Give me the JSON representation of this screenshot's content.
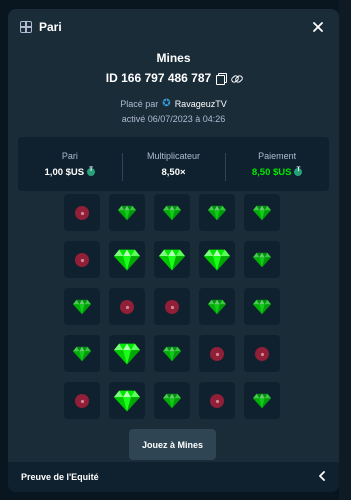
{
  "modal": {
    "title": "Pari",
    "game_name": "Mines",
    "bet_id": "ID 166 797 486 787",
    "placed_by_prefix": "Placé par",
    "placed_by_user": "RavageuzTV",
    "active_date": "activé 06/07/2023 à 04:26"
  },
  "stats": {
    "bet_label": "Pari",
    "bet_value": "1,00 $US",
    "multiplier_label": "Multiplicateur",
    "multiplier_value": "8,50×",
    "payout_label": "Paiement",
    "payout_value": "8,50 $US",
    "payout_color": "#00e701"
  },
  "grid": {
    "rows": [
      [
        "mine",
        "gem",
        "gem",
        "gem",
        "gem"
      ],
      [
        "mine",
        "gem-revealed",
        "gem-revealed",
        "gem-revealed",
        "gem"
      ],
      [
        "gem",
        "mine",
        "mine",
        "gem",
        "gem"
      ],
      [
        "gem",
        "gem-revealed",
        "gem",
        "mine",
        "mine"
      ],
      [
        "mine",
        "gem-revealed",
        "gem",
        "mine",
        "gem"
      ]
    ],
    "gem_color": "#00e701",
    "mine_color": "#a81e3a"
  },
  "play_button": "Jouez à Mines",
  "fairness": {
    "label": "Preuve de l'Equité"
  },
  "icons": {
    "header": "mines-grid-icon",
    "close": "close-icon",
    "copy": "copy-icon",
    "link": "link-icon",
    "user": "star-icon",
    "currency": "tether-coin-icon",
    "expand": "chevron-left-icon"
  }
}
